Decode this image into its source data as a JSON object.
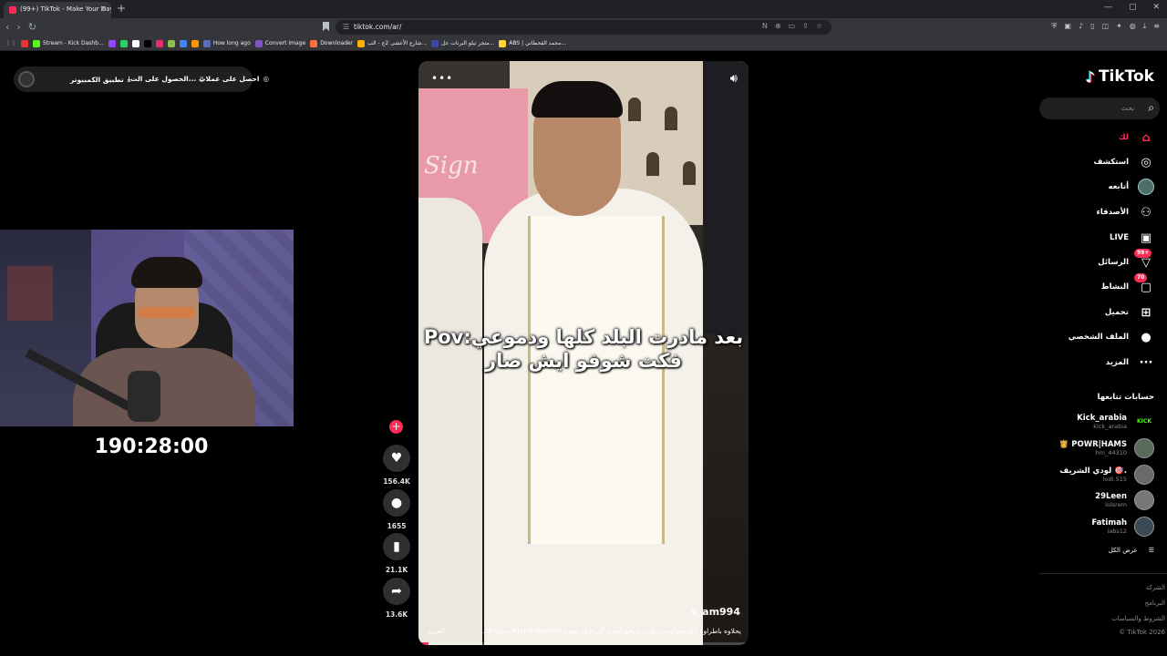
{
  "browser": {
    "tab_title": "(99+) TikTok - Make Your Day",
    "url": "tiktok.com/ar/",
    "bookmarks": [
      {
        "label": "",
        "color": "#e53935"
      },
      {
        "label": "Stream - Kick Dashb...",
        "color": "#53fc18"
      },
      {
        "label": "",
        "color": "#9146ff"
      },
      {
        "label": "",
        "color": "#25d366"
      },
      {
        "label": "",
        "color": "#ffffff"
      },
      {
        "label": "",
        "color": "#000000"
      },
      {
        "label": "",
        "color": "#e1306c"
      },
      {
        "label": "",
        "color": "#8bc34a"
      },
      {
        "label": "",
        "color": "#4285f4"
      },
      {
        "label": "",
        "color": "#ff9800"
      },
      {
        "label": "How long ago",
        "color": "#5c6bc0"
      },
      {
        "label": "Convert Image",
        "color": "#7e57c2"
      },
      {
        "label": "Downloader",
        "color": "#ff7043"
      },
      {
        "label": "شارع الأعشى 2ج - الب...",
        "color": "#ffb300"
      },
      {
        "label": "متجر تيلو البرنات عل...",
        "color": "#3949ab"
      },
      {
        "label": "ABS | محمد القحطاني...",
        "color": "#fdd835"
      }
    ]
  },
  "top_pill": {
    "get_coins": "احصل على عملات",
    "get_app": "الحصول على الت...",
    "desktop_app": "تطبيق الكمبيوتر"
  },
  "stream": {
    "timer": "190:28:00"
  },
  "video": {
    "caption_line1": "بعد مادرت البلد كلها ودموعي:Pov",
    "caption_line2": "فكت شوفو ايش صار",
    "sign_text": "Sign",
    "username": "s_am994",
    "description": "يحلاوه باطراوه الله بحراه حي بابت شوفو القديه الى قبل تقهمو fyp# explore# سماح#...",
    "more": "المزيد",
    "progress": 0.03
  },
  "actions": {
    "likes": "156.4K",
    "comments": "1655",
    "saves": "21.1K",
    "shares": "13.6K"
  },
  "sidebar": {
    "brand": "TikTok",
    "search_placeholder": "بحث",
    "nav": [
      {
        "label": "لك",
        "icon": "home-icon",
        "active": true
      },
      {
        "label": "استكشف",
        "icon": "compass-icon"
      },
      {
        "label": "أتابعه",
        "icon": "following-avatar-icon"
      },
      {
        "label": "الأصدقاء",
        "icon": "friends-icon"
      },
      {
        "label": "LIVE",
        "icon": "live-icon"
      },
      {
        "label": "الرسائل",
        "icon": "messages-icon",
        "badge": "99+"
      },
      {
        "label": "النشاط",
        "icon": "activity-icon",
        "badge": "70"
      },
      {
        "label": "تحميل",
        "icon": "upload-icon"
      },
      {
        "label": "الملف الشخصي",
        "icon": "profile-icon"
      },
      {
        "label": "المزيد",
        "icon": "more-icon"
      }
    ],
    "following_title": "حسابات تتابعها",
    "following": [
      {
        "name": "Kick_arabia",
        "handle": "kick_arabia",
        "avatar": "KICK"
      },
      {
        "name": "👸 POWR|HAMS",
        "handle": "hm_44310",
        "avatar": ""
      },
      {
        "name": "لودي الشريف 🎯.",
        "handle": "lodi.515",
        "avatar": ""
      },
      {
        "name": "29Leen",
        "handle": "lolsrem",
        "avatar": ""
      },
      {
        "name": "Fatimah",
        "handle": "iabs12",
        "avatar": ""
      }
    ],
    "see_all": "عرض الكل",
    "footer": [
      "الشركة",
      "البرنامج",
      "الشروط والسياسات",
      "© TikTok 2026"
    ]
  }
}
